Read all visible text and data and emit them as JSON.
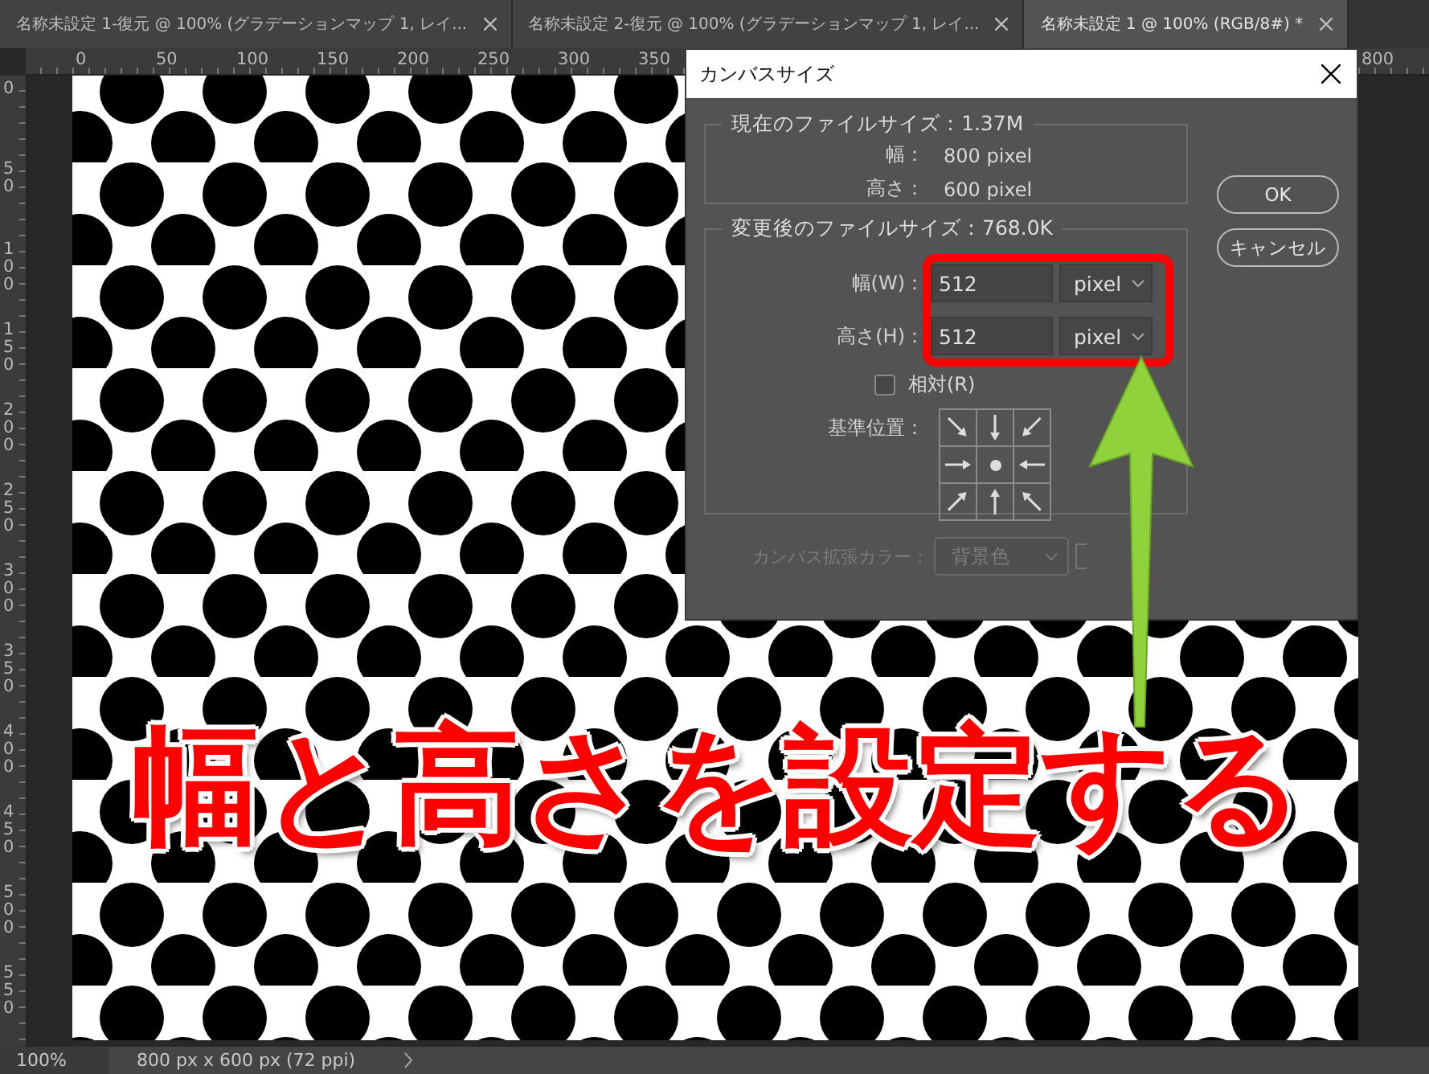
{
  "tabs": [
    {
      "label": "名称未設定 1-復元 @ 100% (グラデーションマップ 1, レイ...",
      "selected": false
    },
    {
      "label": "名称未設定 2-復元 @ 100% (グラデーションマップ 1, レイ...",
      "selected": false
    },
    {
      "label": "名称未設定 1 @ 100% (RGB/8#) *",
      "selected": true
    }
  ],
  "ruler": {
    "horizontal": [
      "0",
      "50",
      "100",
      "150",
      "200",
      "250",
      "300",
      "350",
      "800"
    ],
    "vertical": [
      "0",
      "50",
      "100",
      "150",
      "200",
      "250",
      "300",
      "350",
      "400",
      "450",
      "500",
      "550"
    ]
  },
  "dialog": {
    "title": "カンバスサイズ",
    "current": {
      "legend": "現在のファイルサイズ：1.37M",
      "rows": [
        {
          "label": "幅：",
          "value": "800 pixel"
        },
        {
          "label": "高さ：",
          "value": "600 pixel"
        }
      ]
    },
    "new": {
      "legend": "変更後のファイルサイズ：768.0K",
      "fields": [
        {
          "label": "幅(W)：",
          "value": "512",
          "unit": "pixel"
        },
        {
          "label": "高さ(H)：",
          "value": "512",
          "unit": "pixel"
        }
      ],
      "relative": {
        "label": "相対(R)",
        "checked": false
      },
      "anchor": {
        "label": "基準位置：",
        "cells": [
          {
            "selected": false
          },
          {
            "selected": false
          },
          {
            "selected": false
          },
          {
            "selected": false
          },
          {
            "selected": true
          },
          {
            "selected": false
          },
          {
            "selected": false
          },
          {
            "selected": false
          },
          {
            "selected": false
          }
        ]
      }
    },
    "extension_color": {
      "label": "カンバス拡張カラー：",
      "value": "背景色",
      "disabled": true
    },
    "buttons": [
      "OK",
      "キャンセル"
    ]
  },
  "annotation": {
    "text": "幅と高さを設定する"
  },
  "status_bar": {
    "zoom": "100%",
    "info": "800 px x 600 px (72 ppi)"
  }
}
